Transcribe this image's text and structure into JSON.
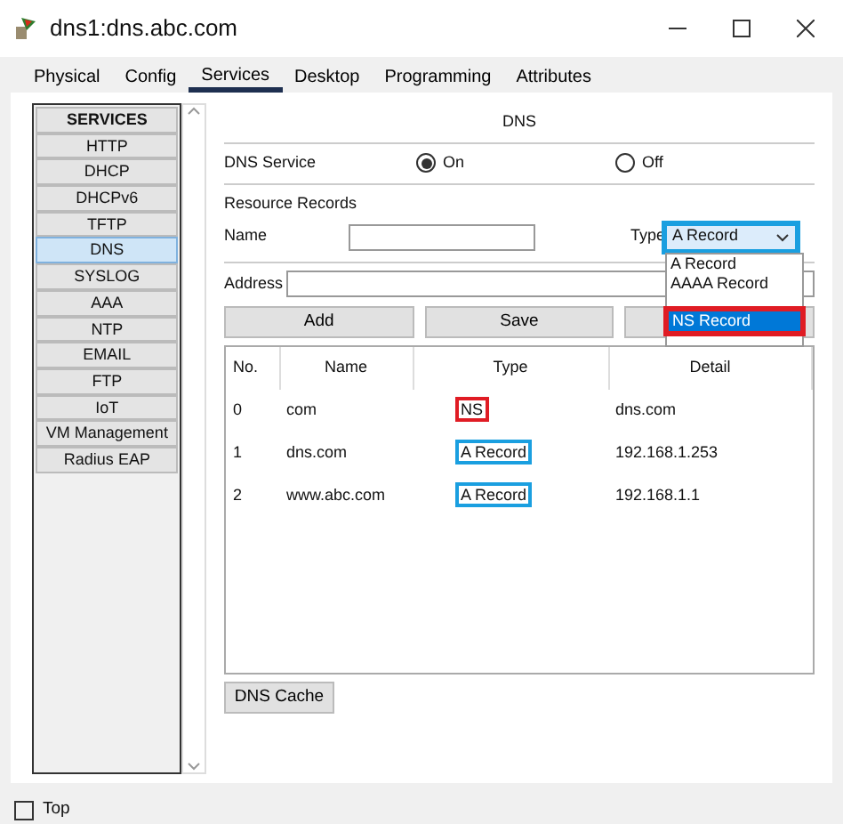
{
  "window": {
    "title": "dns1:dns.abc.com"
  },
  "tabs": [
    {
      "label": "Physical",
      "selected": false
    },
    {
      "label": "Config",
      "selected": false
    },
    {
      "label": "Services",
      "selected": true
    },
    {
      "label": "Desktop",
      "selected": false
    },
    {
      "label": "Programming",
      "selected": false
    },
    {
      "label": "Attributes",
      "selected": false
    }
  ],
  "sidebar": {
    "header": "SERVICES",
    "items": [
      {
        "label": "HTTP",
        "selected": false
      },
      {
        "label": "DHCP",
        "selected": false
      },
      {
        "label": "DHCPv6",
        "selected": false
      },
      {
        "label": "TFTP",
        "selected": false
      },
      {
        "label": "DNS",
        "selected": true
      },
      {
        "label": "SYSLOG",
        "selected": false
      },
      {
        "label": "AAA",
        "selected": false
      },
      {
        "label": "NTP",
        "selected": false
      },
      {
        "label": "EMAIL",
        "selected": false
      },
      {
        "label": "FTP",
        "selected": false
      },
      {
        "label": "IoT",
        "selected": false
      },
      {
        "label": "VM Management",
        "selected": false
      },
      {
        "label": "Radius EAP",
        "selected": false
      }
    ]
  },
  "panel": {
    "title": "DNS",
    "service_label": "DNS Service",
    "service_options": [
      {
        "label": "On",
        "selected": true
      },
      {
        "label": "Off",
        "selected": false
      }
    ],
    "resource_records_label": "Resource Records",
    "name_label": "Name",
    "type_label": "Type",
    "type_select": {
      "value": "A Record",
      "color": "#1a9fe0"
    },
    "type_options": [
      {
        "label": "A Record",
        "selected": false
      },
      {
        "label": "AAAA Record",
        "selected": false
      },
      {
        "label": "NS Record",
        "selected": true,
        "color": "#e01c24"
      }
    ],
    "address_label": "Address",
    "buttons": [
      "Add",
      "Save"
    ],
    "table": {
      "columns": [
        "No.",
        "Name",
        "Type",
        "Detail"
      ],
      "rows": [
        {
          "no": "0",
          "name": "com",
          "type": "NS",
          "detail": "dns.com",
          "color": "#e01c24"
        },
        {
          "no": "1",
          "name": "dns.com",
          "type": "A Record",
          "detail": "192.168.1.253",
          "color": "#1a9fe0"
        },
        {
          "no": "2",
          "name": "www.abc.com",
          "type": "A Record",
          "detail": "192.168.1.1",
          "color": "#1a9fe0"
        }
      ]
    },
    "cache_button": "DNS Cache"
  },
  "top_checkbox": {
    "label": "Top",
    "checked": false
  }
}
